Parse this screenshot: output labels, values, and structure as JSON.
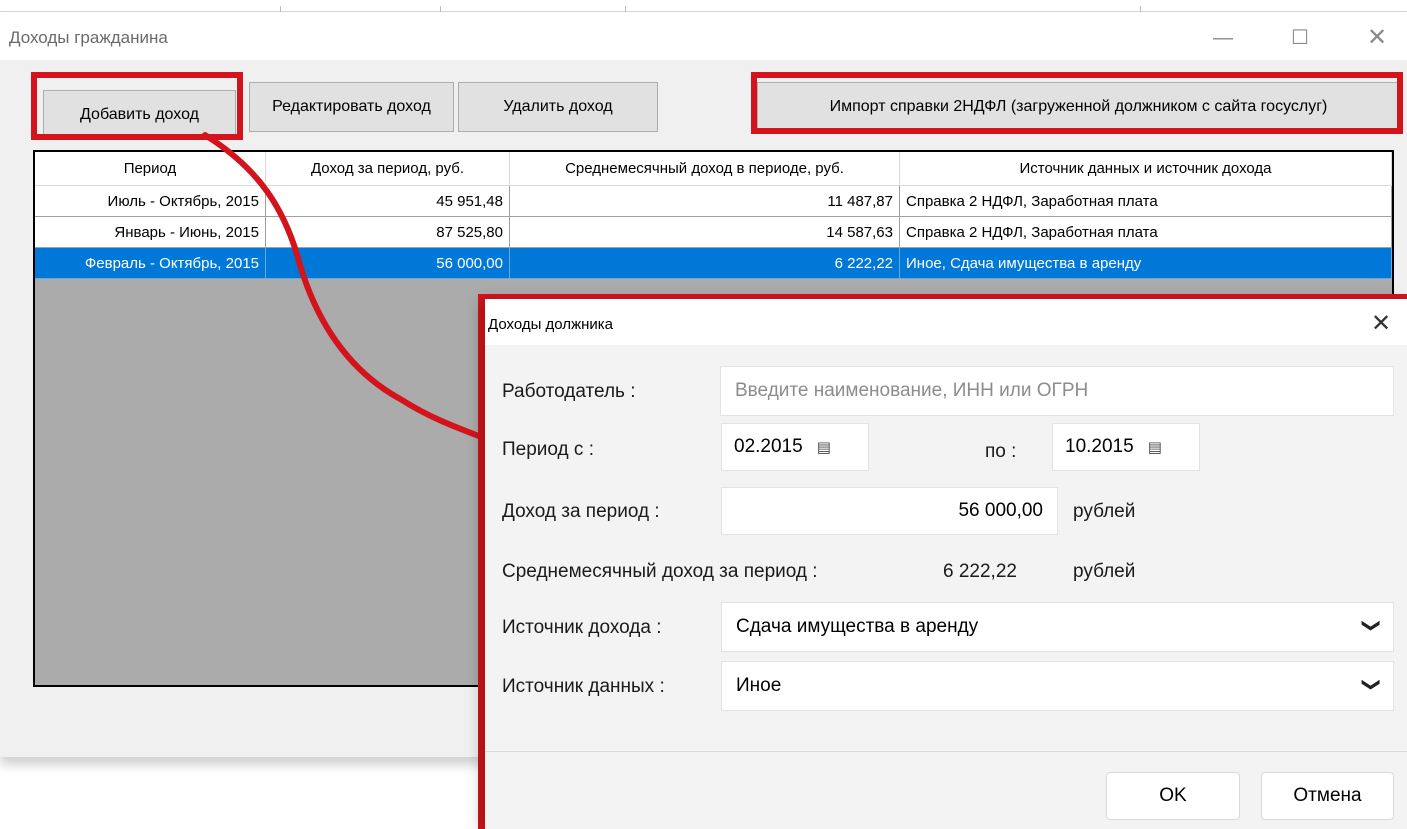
{
  "window": {
    "title": "Доходы гражданина",
    "minimize_glyph": "—",
    "maximize_glyph": "☐",
    "close_glyph": "✕"
  },
  "toolbar": {
    "add_label": "Добавить доход",
    "edit_label": "Редактировать доход",
    "delete_label": "Удалить доход",
    "import_label": "Импорт справки 2НДФЛ (загруженной должником с сайта госуслуг)"
  },
  "table": {
    "columns": [
      "Период",
      "Доход за период, руб.",
      "Среднемесячный доход в периоде, руб.",
      "Источник данных и источник дохода"
    ],
    "rows": [
      {
        "period": "Июль - Октябрь, 2015",
        "income": "45 951,48",
        "avg": "11 487,87",
        "source": "Справка 2 НДФЛ, Заработная плата"
      },
      {
        "period": "Январь - Июнь, 2015",
        "income": "87 525,80",
        "avg": "14 587,63",
        "source": "Справка 2 НДФЛ, Заработная плата"
      },
      {
        "period": "Февраль - Октябрь, 2015",
        "income": "56 000,00",
        "avg": "6 222,22",
        "source": "Иное, Сдача имущества в аренду"
      }
    ],
    "selected_row": 2
  },
  "dialog": {
    "title": "Доходы должника",
    "close_glyph": "✕",
    "employer_label": "Работодатель :",
    "employer_placeholder": "Введите наименование, ИНН или ОГРН",
    "period_from_label": "Период с :",
    "period_from_value": "02.2015",
    "period_to_label": "по :",
    "period_to_value": "10.2015",
    "income_label": "Доход за период :",
    "income_value": "56 000,00",
    "currency_label": "рублей",
    "avg_label": "Среднемесячный доход за период :",
    "avg_value": "6 222,22",
    "avg_currency_label": "рублей",
    "income_source_label": "Источник дохода :",
    "income_source_value": "Сдача имущества в аренду",
    "data_source_label": "Источник данных :",
    "data_source_value": "Иное",
    "ok_label": "OK",
    "cancel_label": "Отмена"
  },
  "colors": {
    "highlight_red": "#d4141c",
    "selection_blue": "#0078d7"
  },
  "icons": {
    "calendar": "calendar-icon",
    "chevron": "chevron-down-icon"
  }
}
